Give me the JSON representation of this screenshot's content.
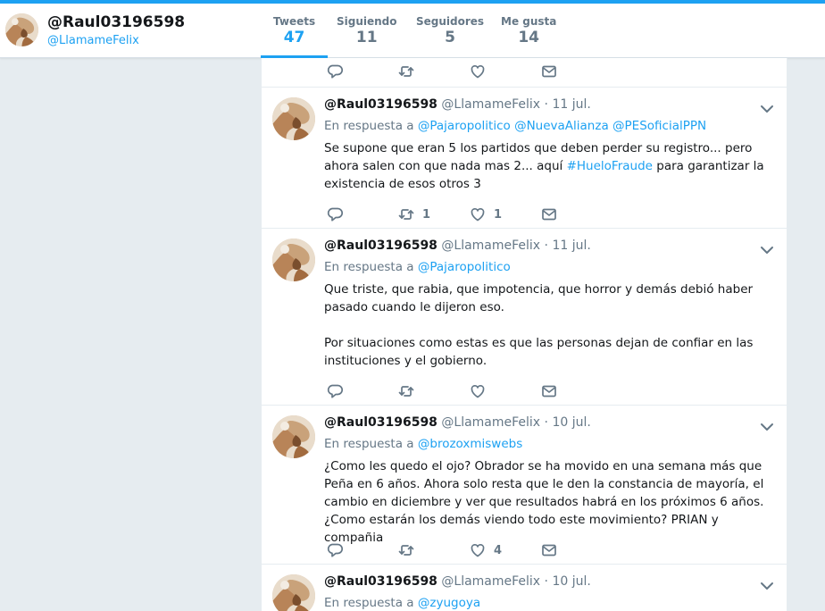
{
  "profile": {
    "name": "@Raul03196598",
    "handle": "@LlamameFelix",
    "stats": [
      {
        "label": "Tweets",
        "value": "47",
        "active": true
      },
      {
        "label": "Siguiendo",
        "value": "11",
        "active": false
      },
      {
        "label": "Seguidores",
        "value": "5",
        "active": false
      },
      {
        "label": "Me gusta",
        "value": "14",
        "active": false
      }
    ]
  },
  "tweets": [
    {
      "name": "@Raul03196598",
      "handle": "@LlamameFelix",
      "dot": "·",
      "date": "11 jul.",
      "reply_prefix": "En respuesta a",
      "reply_to": [
        "@Pajaropolitico",
        "@NuevaAlianza",
        "@PESoficialPPN"
      ],
      "text_before": "Se supone que eran 5 los partidos que deben perder su registro... pero ahora salen con que nada mas 2... aquí ",
      "hashtag": "#HueloFraude",
      "text_after": " para garantizar la existencia de esos otros 3",
      "retweets": "1",
      "likes": "1"
    },
    {
      "name": "@Raul03196598",
      "handle": "@LlamameFelix",
      "dot": "·",
      "date": "11 jul.",
      "reply_prefix": "En respuesta a",
      "reply_to": [
        "@Pajaropolitico"
      ],
      "para1": "Que triste, que rabia, que impotencia, que horror y demás debió haber pasado cuando le dijeron eso.",
      "para2": "Por situaciones como estas es que las personas dejan de confiar en las instituciones y el gobierno.",
      "retweets": "",
      "likes": ""
    },
    {
      "name": "@Raul03196598",
      "handle": "@LlamameFelix",
      "dot": "·",
      "date": "10 jul.",
      "reply_prefix": "En respuesta a",
      "reply_to": [
        "@brozoxmiswebs"
      ],
      "text": "¿Como les quedo el ojo? Obrador se ha movido en una semana más que Peña en 6 años. Ahora solo resta que le den la constancia de mayoría, el cambio en diciembre y ver que resultados habrá en los próximos 6 años. ¿Como estarán los demás viendo todo este movimiento? PRIAN y compañia",
      "retweets": "",
      "likes": "4"
    },
    {
      "name": "@Raul03196598",
      "handle": "@LlamameFelix",
      "dot": "·",
      "date": "10 jul.",
      "reply_prefix": "En respuesta a",
      "reply_to": [
        "@zyugoya"
      ]
    }
  ],
  "icons": {
    "reply": "reply-icon",
    "retweet": "retweet-icon",
    "like": "heart-icon",
    "message": "envelope-icon",
    "caret": "chevron-down-icon"
  },
  "colors": {
    "accent": "#1da1f2",
    "text": "#14171a",
    "muted": "#657786",
    "background": "#e6ecf0"
  }
}
